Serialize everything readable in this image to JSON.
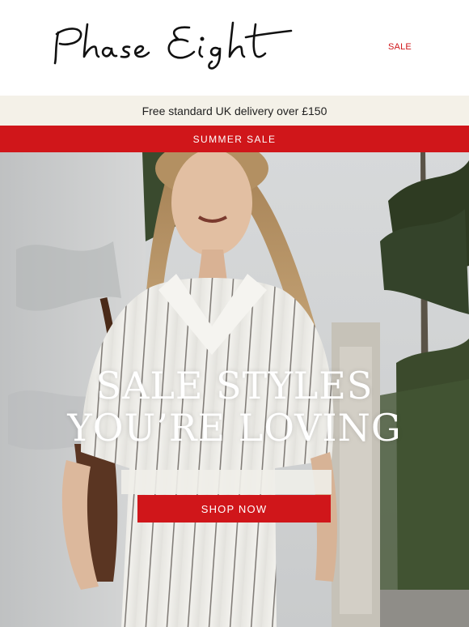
{
  "header": {
    "logo_text": "Phase Eight",
    "sale_link": "SALE"
  },
  "delivery_bar": {
    "text": "Free standard UK delivery over £150"
  },
  "promo_bar": {
    "label": "SUMMER SALE"
  },
  "hero": {
    "title_line1": "SALE STYLES",
    "title_line2": "YOU’RE LOVING",
    "cta_label": "SHOP NOW"
  },
  "colors": {
    "brand_red": "#d0161a",
    "delivery_bg": "#f4f1e8",
    "text_dark": "#1f1f1f",
    "white": "#ffffff"
  }
}
